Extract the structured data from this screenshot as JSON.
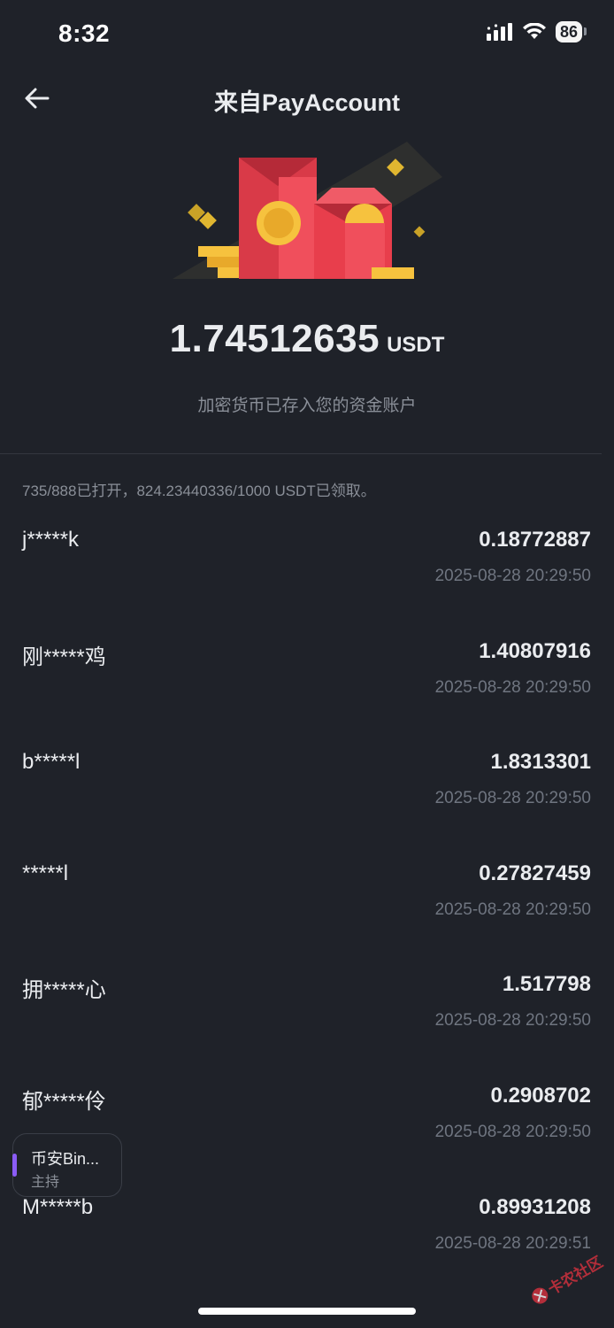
{
  "status_bar": {
    "time": "8:32",
    "battery": "86"
  },
  "nav": {
    "title": "来自PayAccount"
  },
  "hero": {
    "amount": "1.74512635",
    "unit": "USDT",
    "note": "加密货币已存入您的资金账户"
  },
  "summary": "735/888已打开，824.23440336/1000 USDT已领取。",
  "claims": [
    {
      "name": "j*****k",
      "amount": "0.18772887",
      "time": "2025-08-28 20:29:50"
    },
    {
      "name": "刚*****鸡",
      "amount": "1.40807916",
      "time": "2025-08-28 20:29:50"
    },
    {
      "name": "b*****l",
      "amount": "1.8313301",
      "time": "2025-08-28 20:29:50"
    },
    {
      "name": "*****l",
      "amount": "0.27827459",
      "time": "2025-08-28 20:29:50"
    },
    {
      "name": "拥*****心",
      "amount": "1.517798",
      "time": "2025-08-28 20:29:50"
    },
    {
      "name": "郁*****伶",
      "amount": "0.2908702",
      "time": "2025-08-28 20:29:50"
    },
    {
      "name": "M*****b",
      "amount": "0.89931208",
      "time": "2025-08-28 20:29:51"
    }
  ],
  "host_chip": {
    "title": "币安Bin...",
    "role": "主持"
  },
  "watermark": {
    "text": "卡农社区"
  },
  "colors": {
    "background": "#1f2229",
    "envelope_red": "#e8424f",
    "coin_gold": "#f6c23e",
    "host_accent": "#8b5cf6"
  }
}
